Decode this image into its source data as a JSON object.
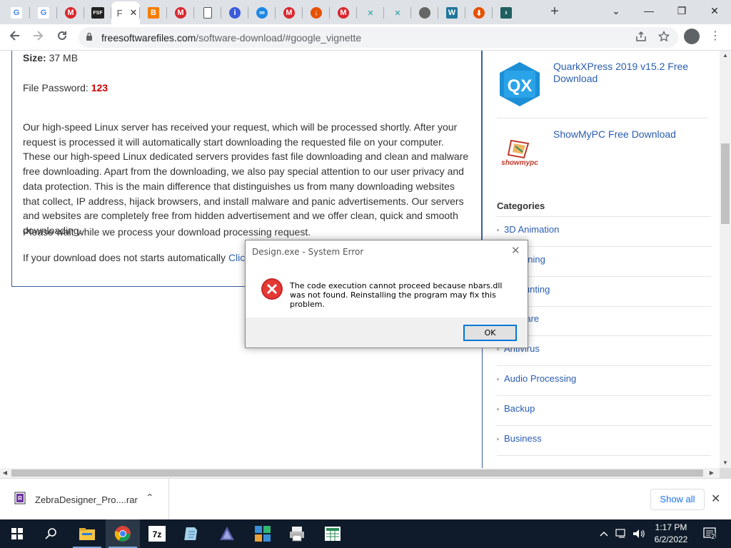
{
  "browser": {
    "tabs": [
      {
        "icon": "google-icon",
        "glyph": "G"
      },
      {
        "icon": "google-icon",
        "glyph": "G"
      },
      {
        "icon": "mega-icon",
        "glyph": "M"
      },
      {
        "icon": "fsf-icon",
        "glyph": "FSF"
      },
      {
        "icon": "page-icon",
        "glyph": "F",
        "active": true,
        "close": "✕"
      },
      {
        "icon": "blogger-icon",
        "glyph": "B"
      },
      {
        "icon": "mega-icon",
        "glyph": "M"
      },
      {
        "icon": "document-icon",
        "glyph": ""
      },
      {
        "icon": "info-icon",
        "glyph": "i"
      },
      {
        "icon": "link-icon",
        "glyph": "∞"
      },
      {
        "icon": "mega-icon",
        "glyph": "M"
      },
      {
        "icon": "download-icon",
        "glyph": "↓"
      },
      {
        "icon": "mega-icon",
        "glyph": "M"
      },
      {
        "icon": "cross-icon",
        "glyph": "✕"
      },
      {
        "icon": "cross-icon",
        "glyph": "✕"
      },
      {
        "icon": "globe-icon",
        "glyph": "●"
      },
      {
        "icon": "wordpress-icon",
        "glyph": "W"
      },
      {
        "icon": "download-icon",
        "glyph": "⬇"
      },
      {
        "icon": "arrow-icon",
        "glyph": "›"
      }
    ],
    "new_tab": "+",
    "window_buttons": {
      "dropdown": "⌄",
      "minimize": "—",
      "restore": "❐",
      "close": "✕"
    },
    "url_host": "freesoftwarefiles.com",
    "url_path": "/software-download/#google_vignette"
  },
  "page": {
    "size_label": "Size:",
    "size_value": "37 MB",
    "password_label": "File Password:",
    "password_value": "123",
    "body_text": "Our high-speed Linux server has received your request, which will be processed shortly. After your request is processed it will automatically start downloading the requested file on your computer. These our high-speed Linux dedicated servers provides fast file downloading and clean and malware free downloading. Apart from the downloading, we also pay special attention to our user privacy and data protection. This is the main difference that distinguishes us from many downloading websites that collect, IP address, hijack browsers, and install malware and panic advertisements. Our servers and websites are completely free from hidden advertisement and we offer clean, quick and smooth downloading.",
    "wait_text": "Please wait while we process your download processing request.",
    "auto_text": "If your download does not starts automatically",
    "auto_link": "Click He"
  },
  "sidebar": {
    "products": [
      {
        "title": "QuarkXPress 2019 v15.2 Free Download",
        "logo_text": "QX"
      },
      {
        "title": "ShowMyPC Free Download",
        "logo_text": "showmypc"
      }
    ],
    "categories_heading": "Categories",
    "categories": [
      "3D Animation",
      "Designing",
      "Accounting",
      "Malware",
      "Antivirus",
      "Audio Processing",
      "Backup",
      "Business"
    ],
    "categories_visible": [
      "3D Animation",
      "esigning",
      "unting",
      "Malware",
      "Antivirus",
      "Audio Processing",
      "Backup",
      "Business"
    ]
  },
  "dialog": {
    "title": "Design.exe - System Error",
    "message": "The code execution cannot proceed because nbars.dll was not found. Reinstalling the program may fix this problem.",
    "ok_label": "OK",
    "close_glyph": "✕"
  },
  "downloads": {
    "file_name": "ZebraDesigner_Pro....rar",
    "show_all": "Show all",
    "close_glyph": "✕"
  },
  "taskbar": {
    "time": "1:17 PM",
    "date": "6/2/2022",
    "notification_count": "2",
    "apps": [
      "start-icon",
      "search-icon",
      "file-explorer-icon",
      "chrome-icon",
      "7zip-icon",
      "notepad-icon",
      "inkscape-icon",
      "app-grid-icon",
      "printer-icon",
      "spreadsheet-icon"
    ]
  },
  "colors": {
    "link": "#2a5db0",
    "password": "#cc0000",
    "accent_border": "#3a5fa0",
    "taskbar": "#0f1b2a",
    "error_red": "#d32f2f"
  }
}
